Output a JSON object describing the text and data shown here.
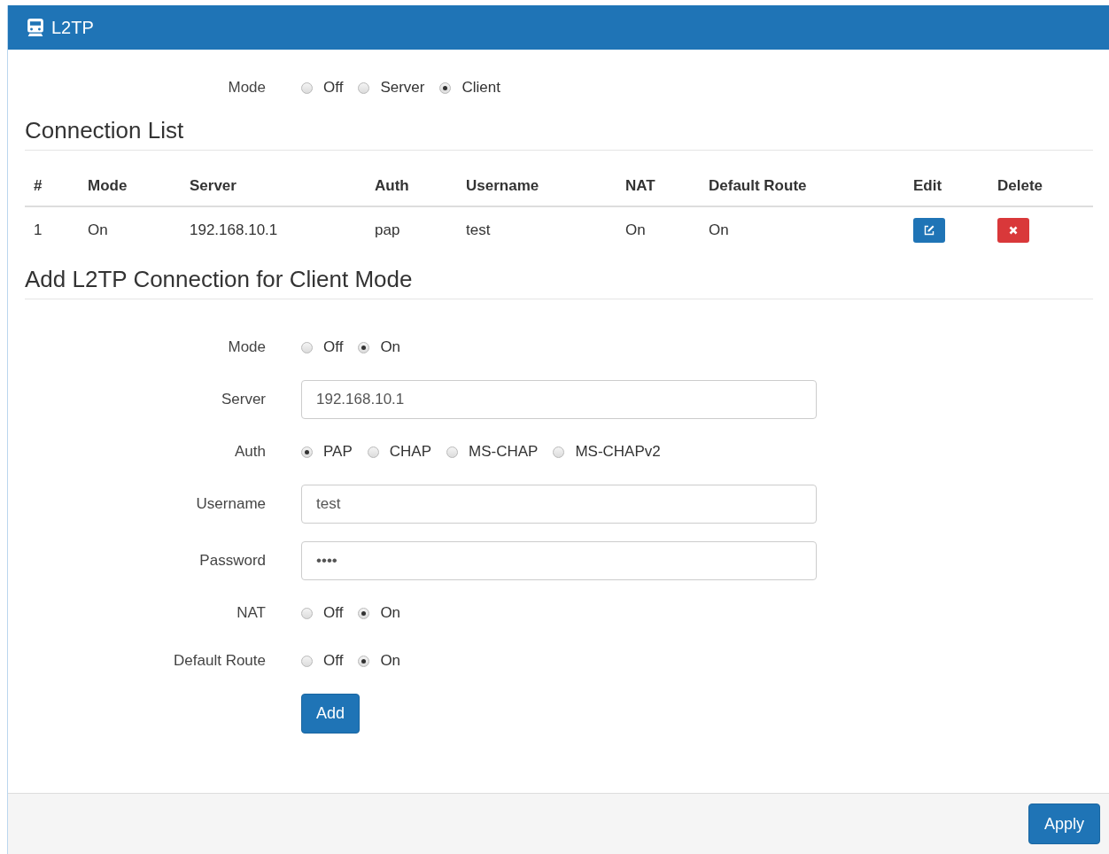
{
  "panel": {
    "title": "L2TP"
  },
  "mode": {
    "label": "Mode",
    "options": [
      {
        "label": "Off",
        "selected": false
      },
      {
        "label": "Server",
        "selected": false
      },
      {
        "label": "Client",
        "selected": true
      }
    ]
  },
  "connection_list": {
    "heading": "Connection List",
    "columns": [
      "#",
      "Mode",
      "Server",
      "Auth",
      "Username",
      "NAT",
      "Default Route",
      "Edit",
      "Delete"
    ],
    "rows": [
      {
        "cells": [
          "1",
          "On",
          "192.168.10.1",
          "pap",
          "test",
          "On",
          "On"
        ]
      }
    ]
  },
  "add_form": {
    "heading": "Add L2TP Connection for Client Mode",
    "fields": [
      {
        "kind": "radio",
        "label": "Mode",
        "options": [
          {
            "label": "Off",
            "selected": false
          },
          {
            "label": "On",
            "selected": true
          }
        ]
      },
      {
        "kind": "text",
        "label": "Server",
        "value": "192.168.10.1"
      },
      {
        "kind": "radio",
        "label": "Auth",
        "options": [
          {
            "label": "PAP",
            "selected": true
          },
          {
            "label": "CHAP",
            "selected": false
          },
          {
            "label": "MS-CHAP",
            "selected": false
          },
          {
            "label": "MS-CHAPv2",
            "selected": false
          }
        ]
      },
      {
        "kind": "text",
        "label": "Username",
        "value": "test"
      },
      {
        "kind": "text",
        "label": "Password",
        "value": "••••"
      },
      {
        "kind": "radio",
        "label": "NAT",
        "options": [
          {
            "label": "Off",
            "selected": false
          },
          {
            "label": "On",
            "selected": true
          }
        ]
      },
      {
        "kind": "radio",
        "label": "Default Route",
        "options": [
          {
            "label": "Off",
            "selected": false
          },
          {
            "label": "On",
            "selected": true
          }
        ]
      }
    ],
    "add_button": "Add"
  },
  "footer": {
    "apply_button": "Apply"
  }
}
